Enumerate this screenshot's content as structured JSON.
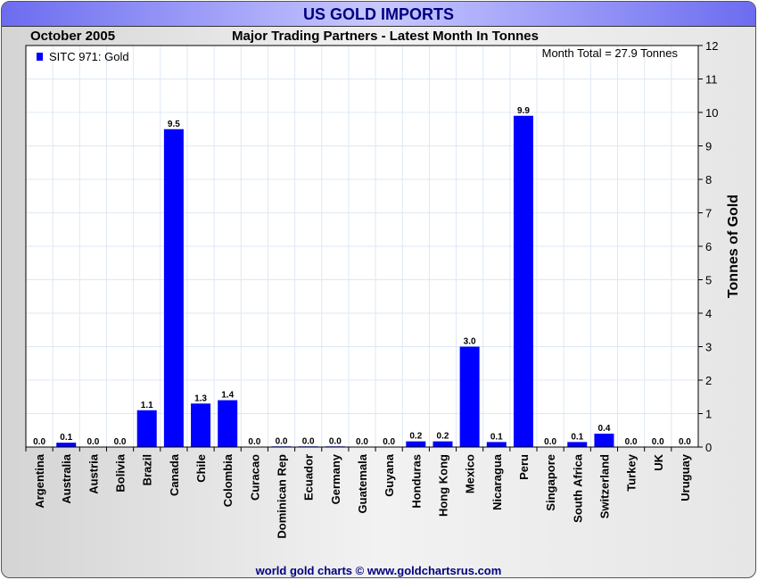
{
  "title": "US GOLD IMPORTS",
  "date": "October 2005",
  "footer": "world gold charts © www.goldchartsrus.com",
  "chart_data": {
    "type": "bar",
    "title": "Major Trading Partners - Latest Month In Tonnes",
    "ylabel": "Tonnes of Gold",
    "ylim": [
      0,
      12
    ],
    "yticks": [
      0,
      1,
      2,
      3,
      4,
      5,
      6,
      7,
      8,
      9,
      10,
      11,
      12
    ],
    "legend": {
      "label": "SITC 971: Gold",
      "color": "#0000ff",
      "position": "top-left"
    },
    "annotation": "Month Total = 27.9 Tonnes",
    "grid": true,
    "categories": [
      "Argentina",
      "Australia",
      "Austria",
      "Bolivia",
      "Brazil",
      "Canada",
      "Chile",
      "Colombia",
      "Curacao",
      "Dominican Rep",
      "Ecuador",
      "Germany",
      "Guatemala",
      "Guyana",
      "Honduras",
      "Hong Kong",
      "Mexico",
      "Nicaragua",
      "Peru",
      "Singapore",
      "South Africa",
      "Switzerland",
      "Turkey",
      "UK",
      "Uruguay"
    ],
    "values": [
      0,
      0.13,
      0,
      0,
      1.1,
      9.5,
      1.3,
      1.4,
      0,
      0.02,
      0.02,
      0.02,
      0,
      0,
      0.17,
      0.17,
      3.0,
      0.15,
      9.9,
      0,
      0.15,
      0.4,
      0,
      0,
      0
    ],
    "labels": [
      "0.0",
      "0.1",
      "0.0",
      "0.0",
      "1.1",
      "9.5",
      "1.3",
      "1.4",
      "0.0",
      "0.0",
      "0.0",
      "0.0",
      "0.0",
      "0.0",
      "0.2",
      "0.2",
      "3.0",
      "0.1",
      "9.9",
      "0.0",
      "0.1",
      "0.4",
      "0.0",
      "0.0",
      "0.0"
    ]
  }
}
